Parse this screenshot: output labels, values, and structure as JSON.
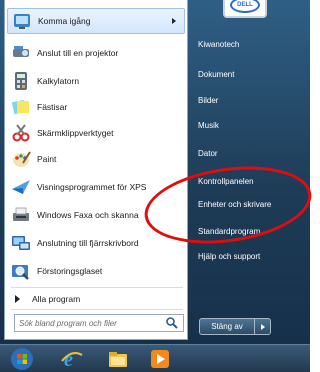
{
  "start_menu": {
    "programs": [
      {
        "label": "Komma igång",
        "icon": "getting-started-icon",
        "has_submenu": true
      },
      {
        "label": "Anslut till en projektor",
        "icon": "projector-icon"
      },
      {
        "label": "Kalkylatorn",
        "icon": "calculator-icon"
      },
      {
        "label": "Fästisar",
        "icon": "sticky-notes-icon"
      },
      {
        "label": "Skärmklippverktyget",
        "icon": "snipping-tool-icon"
      },
      {
        "label": "Paint",
        "icon": "paint-icon"
      },
      {
        "label": "Visningsprogrammet för XPS",
        "icon": "xps-viewer-icon"
      },
      {
        "label": "Windows Faxa och skanna",
        "icon": "fax-scan-icon"
      },
      {
        "label": "Anslutning till fjärrskrivbord",
        "icon": "remote-desktop-icon"
      },
      {
        "label": "Förstoringsglaset",
        "icon": "magnifier-icon"
      }
    ],
    "all_programs": "Alla program",
    "search_placeholder": "Sök bland program och filer",
    "right_items": [
      "Kiwanotech",
      "Dokument",
      "Bilder",
      "Musik",
      "Dator",
      "Kontrollpanelen",
      "Enheter och skrivare",
      "Standardprogram",
      "Hjälp och support"
    ],
    "shutdown_label": "Stäng av",
    "avatar_text": "DELL"
  },
  "colors": {
    "annotation": "#e10d0d",
    "menu_dark": "#1e3c57"
  }
}
